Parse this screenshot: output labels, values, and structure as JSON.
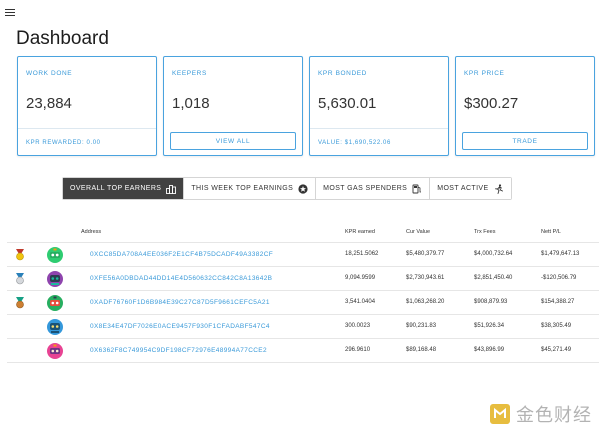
{
  "page": {
    "title": "Dashboard"
  },
  "cards": [
    {
      "label": "WORK DONE",
      "value": "23,884",
      "footer": "KPR REWARDED: 0.00"
    },
    {
      "label": "KEEPERS",
      "value": "1,018",
      "button": "VIEW ALL"
    },
    {
      "label": "KPR BONDED",
      "value": "5,630.01",
      "footer": "VALUE: $1,690,522.06"
    },
    {
      "label": "KPR PRICE",
      "value": "$300.27",
      "button": "TRADE"
    }
  ],
  "tabs": [
    {
      "label": "OVERALL TOP EARNERS",
      "icon": "leaderboard-icon",
      "active": true
    },
    {
      "label": "THIS WEEK TOP EARNINGS",
      "icon": "star-circle-icon",
      "active": false
    },
    {
      "label": "MOST GAS SPENDERS",
      "icon": "gas-pump-icon",
      "active": false
    },
    {
      "label": "MOST ACTIVE",
      "icon": "running-person-icon",
      "active": false
    }
  ],
  "table": {
    "headers": {
      "address": "Address",
      "kpr_earned": "KPR earned",
      "cur_value": "Cur Value",
      "trx_fees": "Trx Fees",
      "nett_pl": "Nett P/L"
    },
    "rows": [
      {
        "medal": "gold-medal-icon",
        "avatar": "green-robot-avatar",
        "address": "0XCC85DA708A4EE036F2E1CF4B75DCADF49A3382CF",
        "kpr_earned": "18,251.5062",
        "cur_value": "$5,480,379.77",
        "trx_fees": "$4,000,732.64",
        "nett_pl": "$1,479,647.13"
      },
      {
        "medal": "silver-medal-icon",
        "avatar": "purple-robot-avatar",
        "address": "0XFE56A0DBDAD44DD14E4D560632CC842C8A13642B",
        "kpr_earned": "9,094.9599",
        "cur_value": "$2,730,943.61",
        "trx_fees": "$2,851,450.40",
        "nett_pl": "-$120,506.79"
      },
      {
        "medal": "bronze-medal-icon",
        "avatar": "green-robot-avatar",
        "address": "0XADF76760F1D6B984E39C27C87D5F9661CEFC5A21",
        "kpr_earned": "3,541.0404",
        "cur_value": "$1,063,268.20",
        "trx_fees": "$908,879.93",
        "nett_pl": "$154,388.27"
      },
      {
        "medal": "",
        "avatar": "blue-robot-avatar",
        "address": "0X8E34E47DF7026E0ACE9457F930F1CFADABF547C4",
        "kpr_earned": "300.0023",
        "cur_value": "$90,231.83",
        "trx_fees": "$51,926.34",
        "nett_pl": "$38,305.49"
      },
      {
        "medal": "",
        "avatar": "pink-robot-avatar",
        "address": "0X6362F8C749954C9DF198CF72976E48994A77CCE2",
        "kpr_earned": "296.9610",
        "cur_value": "$89,168.48",
        "trx_fees": "$43,896.99",
        "nett_pl": "$45,271.49"
      }
    ]
  },
  "watermark": {
    "text": "金色财经"
  },
  "colors": {
    "accent": "#3a9ad9",
    "active_tab": "#424242"
  }
}
